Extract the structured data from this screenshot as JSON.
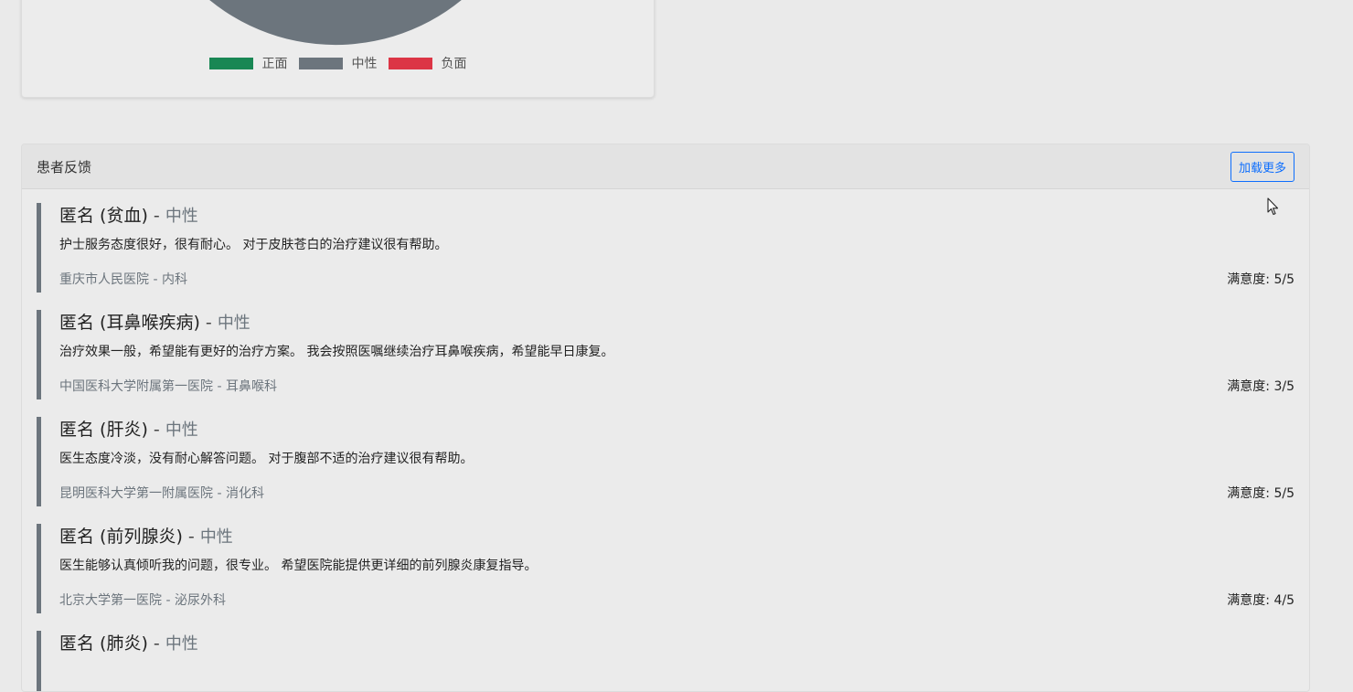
{
  "sentiment_chart": {
    "legend": [
      {
        "label": "正面",
        "color": "#198754"
      },
      {
        "label": "中性",
        "color": "#6c757d"
      },
      {
        "label": "负面",
        "color": "#dc3545"
      }
    ],
    "pie_color": "#6c757d"
  },
  "feedback": {
    "title": "患者反馈",
    "load_more_label": "加载更多",
    "items": [
      {
        "name": "匿名 (贫血)",
        "sep": " - ",
        "sentiment": "中性",
        "text": "护士服务态度很好，很有耐心。 对于皮肤苍白的治疗建议很有帮助。",
        "hospital": "重庆市人民医院 - 内科",
        "score": "满意度: 5/5"
      },
      {
        "name": "匿名 (耳鼻喉疾病)",
        "sep": " - ",
        "sentiment": "中性",
        "text": "治疗效果一般，希望能有更好的治疗方案。 我会按照医嘱继续治疗耳鼻喉疾病，希望能早日康复。",
        "hospital": "中国医科大学附属第一医院 - 耳鼻喉科",
        "score": "满意度: 3/5"
      },
      {
        "name": "匿名 (肝炎)",
        "sep": " - ",
        "sentiment": "中性",
        "text": "医生态度冷淡，没有耐心解答问题。 对于腹部不适的治疗建议很有帮助。",
        "hospital": "昆明医科大学第一附属医院 - 消化科",
        "score": "满意度: 5/5"
      },
      {
        "name": "匿名 (前列腺炎)",
        "sep": " - ",
        "sentiment": "中性",
        "text": "医生能够认真倾听我的问题，很专业。 希望医院能提供更详细的前列腺炎康复指导。",
        "hospital": "北京大学第一医院 - 泌尿外科",
        "score": "满意度: 4/5"
      },
      {
        "name": "匿名 (肺炎)",
        "sep": " - ",
        "sentiment": "中性",
        "text": "",
        "hospital": "",
        "score": ""
      }
    ]
  }
}
